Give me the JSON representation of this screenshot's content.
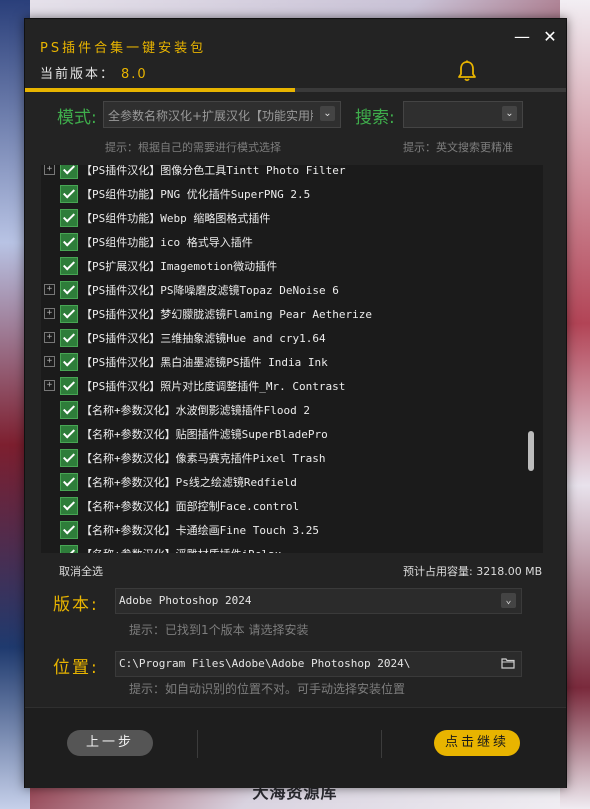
{
  "background": {
    "watermark": "大海资源库"
  },
  "window": {
    "title": "PS插件合集一键安装包",
    "version_label": "当前版本：",
    "version": "8.0",
    "minimize_symbol": "—",
    "close_symbol": "✕",
    "accent_color": "#e8b400"
  },
  "mode": {
    "label": "模式:",
    "selected": "全参数名称汉化+扩展汉化【功能实用版】",
    "hint": "提示：根据自己的需要进行模式选择"
  },
  "search": {
    "label": "搜索:",
    "value": "",
    "hint": "提示：英文搜索更精准"
  },
  "plugin_list": {
    "items": [
      {
        "label": "【PS插件汉化】图像分色工具Tintt Photo Filter",
        "expandable": true,
        "checked": true
      },
      {
        "label": "【PS组件功能】PNG 优化插件SuperPNG 2.5",
        "expandable": false,
        "checked": true
      },
      {
        "label": "【PS组件功能】Webp 缩略图格式插件",
        "expandable": false,
        "checked": true
      },
      {
        "label": "【PS组件功能】ico 格式导入插件",
        "expandable": false,
        "checked": true
      },
      {
        "label": "【PS扩展汉化】Imagemotion微动插件",
        "expandable": false,
        "checked": true
      },
      {
        "label": "【PS插件汉化】PS降噪磨皮滤镜Topaz DeNoise 6",
        "expandable": true,
        "checked": true
      },
      {
        "label": "【PS插件汉化】梦幻朦胧滤镜Flaming Pear Aetherize",
        "expandable": true,
        "checked": true
      },
      {
        "label": "【PS插件汉化】三维抽象滤镜Hue and cry1.64",
        "expandable": true,
        "checked": true
      },
      {
        "label": "【PS插件汉化】黑白油墨滤镜PS插件 India Ink",
        "expandable": true,
        "checked": true
      },
      {
        "label": "【PS插件汉化】照片对比度调整插件_Mr. Contrast",
        "expandable": true,
        "checked": true
      },
      {
        "label": "【名称+参数汉化】水波倒影滤镜插件Flood 2",
        "expandable": false,
        "checked": true
      },
      {
        "label": "【名称+参数汉化】贴图插件滤镜SuperBladePro",
        "expandable": false,
        "checked": true
      },
      {
        "label": "【名称+参数汉化】像素马赛克插件Pixel Trash",
        "expandable": false,
        "checked": true
      },
      {
        "label": "【名称+参数汉化】Ps线之绘滤镜Redfield",
        "expandable": false,
        "checked": true
      },
      {
        "label": "【名称+参数汉化】面部控制Face.control",
        "expandable": false,
        "checked": true
      },
      {
        "label": "【名称+参数汉化】卡通绘画Fine Touch 3.25",
        "expandable": false,
        "checked": true
      },
      {
        "label": "【名称+参数汉化】浮雕材质插件iRelax",
        "expandable": false,
        "checked": true
      }
    ],
    "deselect_all": "取消全选",
    "space_estimate": "预计占用容量: 3218.00 MB"
  },
  "ps_version": {
    "label": "版本:",
    "selected": "Adobe Photoshop 2024",
    "hint": "提示：已找到1个版本 请选择安装"
  },
  "location": {
    "label": "位置:",
    "path": "C:\\Program Files\\Adobe\\Adobe Photoshop 2024\\",
    "hint": "提示：如自动识别的位置不对。可手动选择安装位置"
  },
  "footer": {
    "prev_label": "上一步",
    "next_label": "点击继续"
  }
}
